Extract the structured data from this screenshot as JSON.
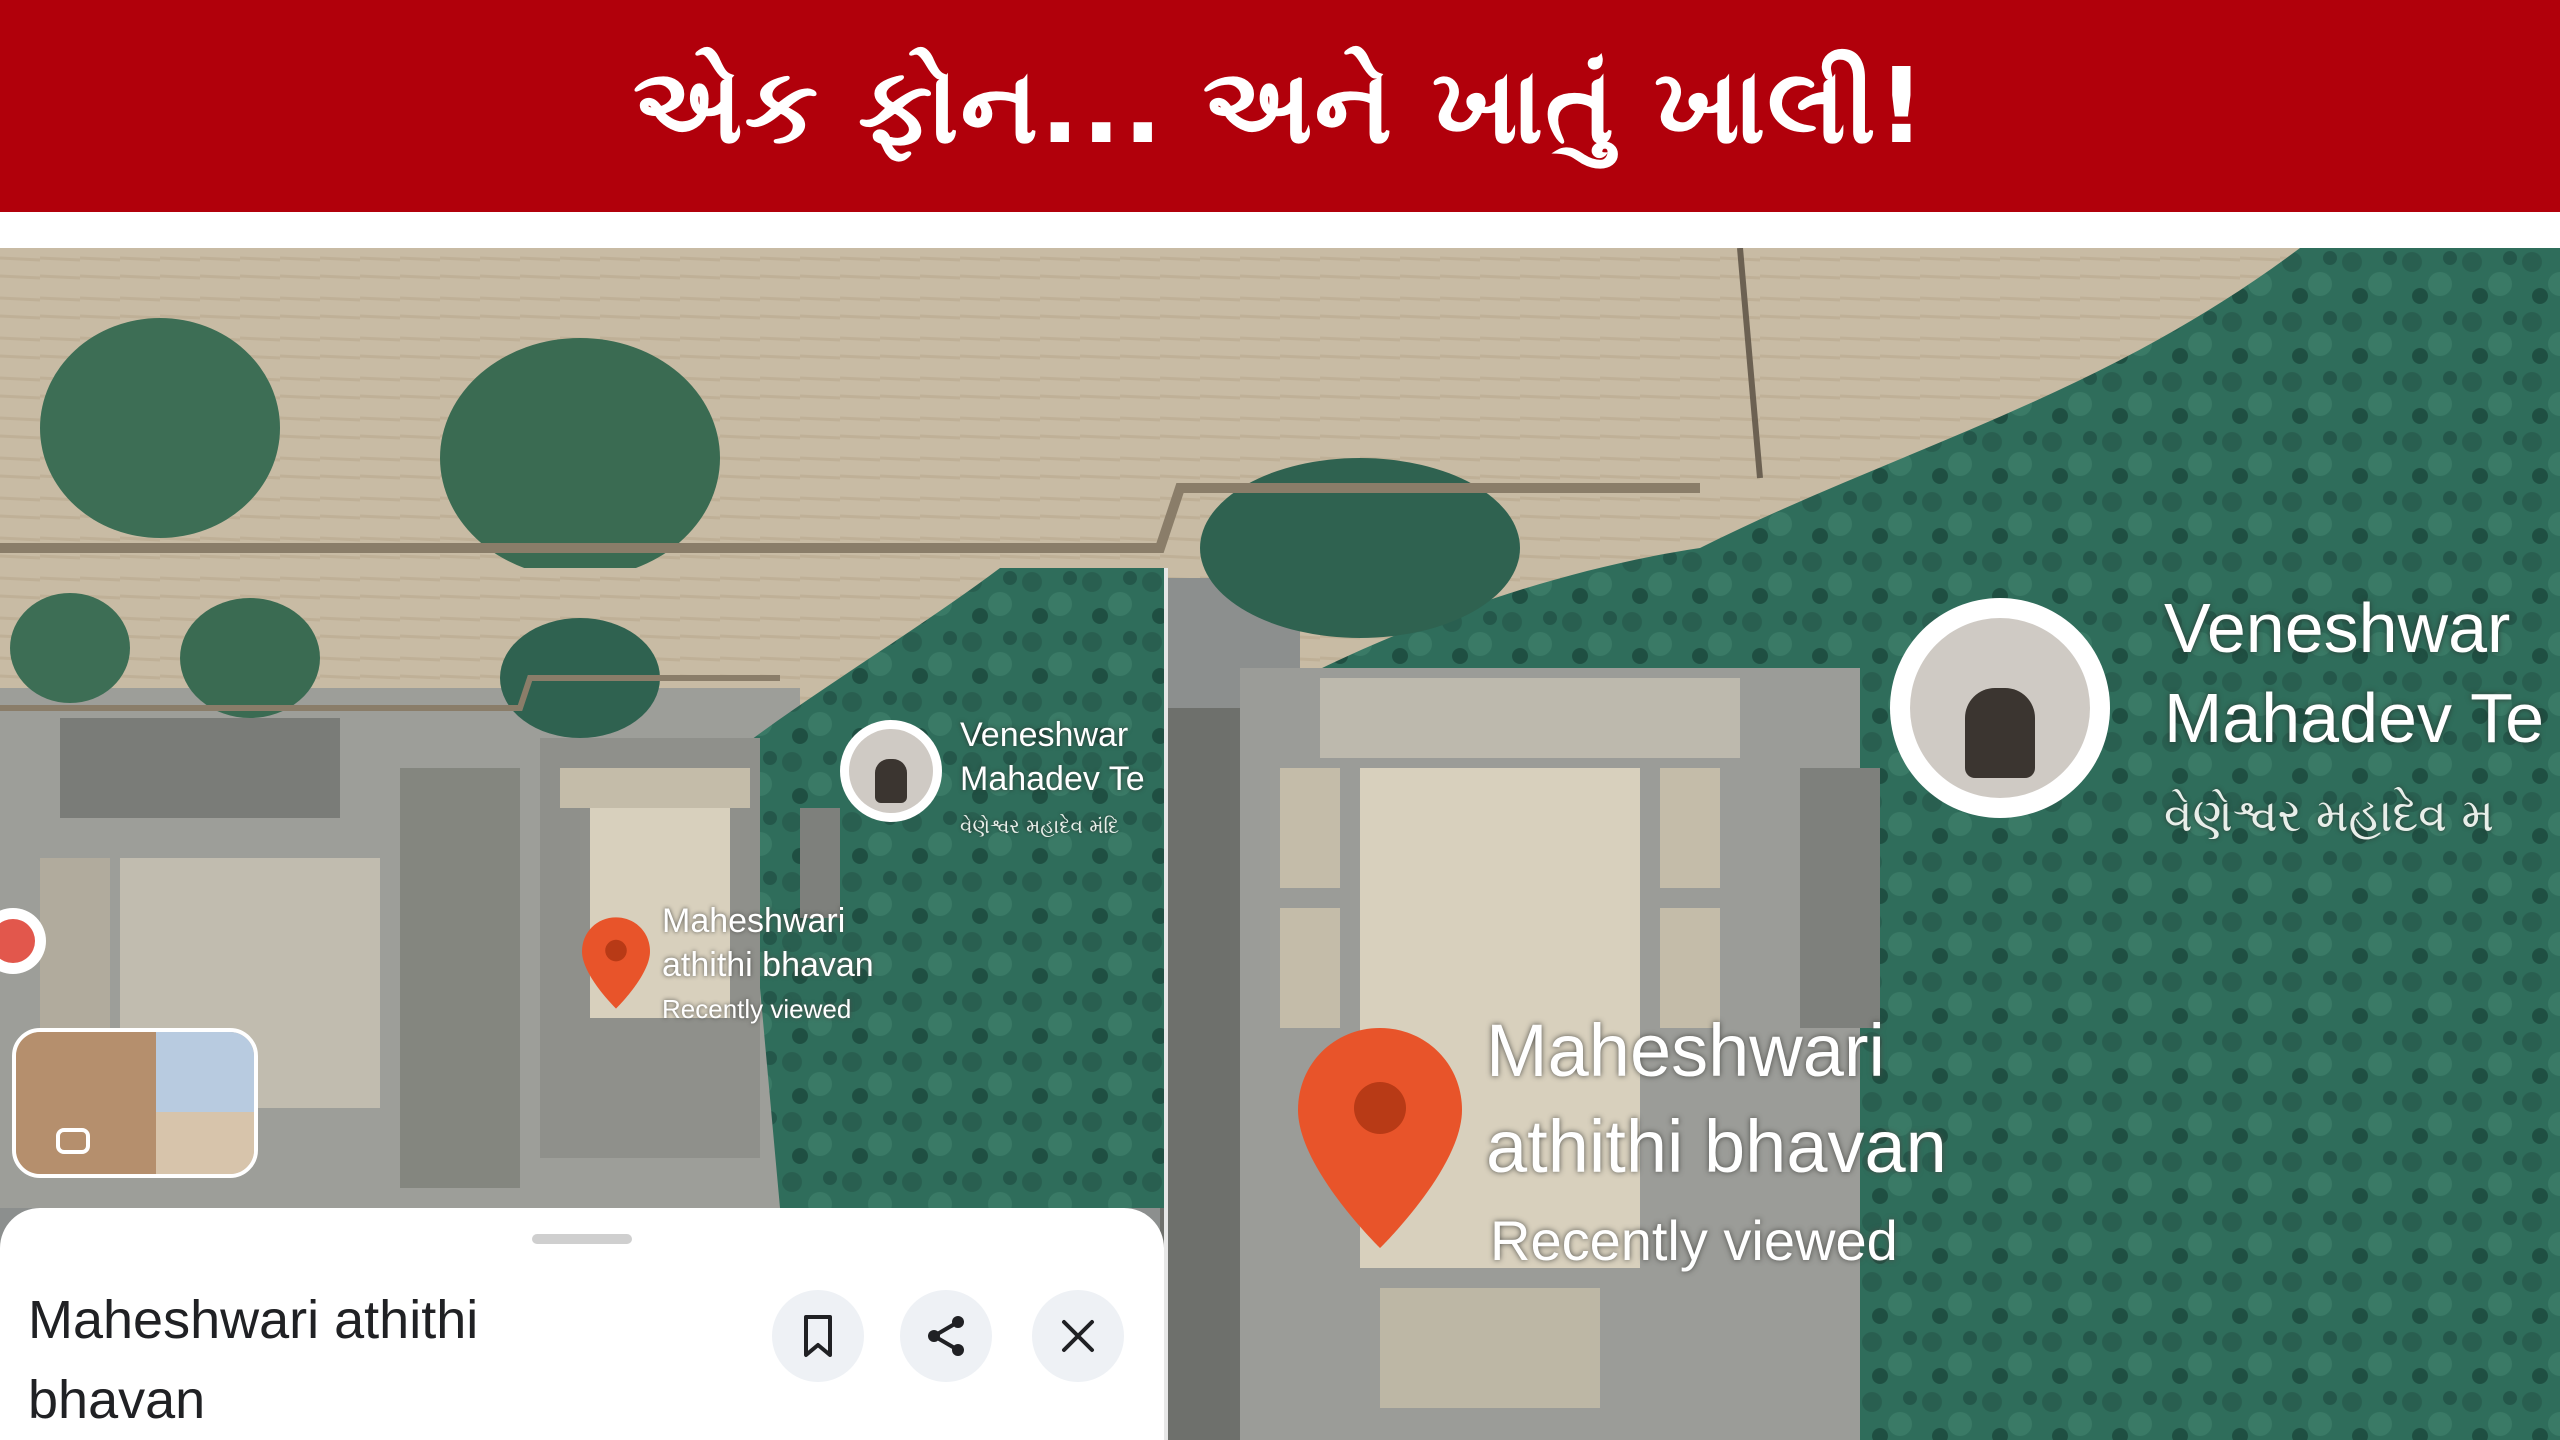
{
  "banner": {
    "title": "એક ફોન... અને ખાતું ખાલી!"
  },
  "map_large": {
    "temple_label": {
      "name_line1": "Veneshwar",
      "name_line2": "Mahadev Te",
      "local_name": "વેણેશ્વર મહાદેવ મ"
    },
    "place_label": {
      "line1": "Maheshwari",
      "line2": "athithi bhavan",
      "status": "Recently viewed"
    }
  },
  "map_inset": {
    "temple_label": {
      "name_line1": "Veneshwar",
      "name_line2": "Mahadev Te",
      "local_name": "વેણેશ્વર મહાદેવ મંદિ"
    },
    "place_label": {
      "line1": "Maheshwari",
      "line2": "athithi bhavan",
      "status": "Recently viewed"
    }
  },
  "bottom_sheet": {
    "title_line1": "Maheshwari athithi",
    "title_line2": "bhavan",
    "save_icon": "bookmark-icon",
    "share_icon": "share-icon",
    "close_icon": "close-icon"
  },
  "colors": {
    "banner": "#b1000b",
    "pin": "#e8542a",
    "vegetation": "#2f6e5c",
    "field": "#c9bca6"
  }
}
